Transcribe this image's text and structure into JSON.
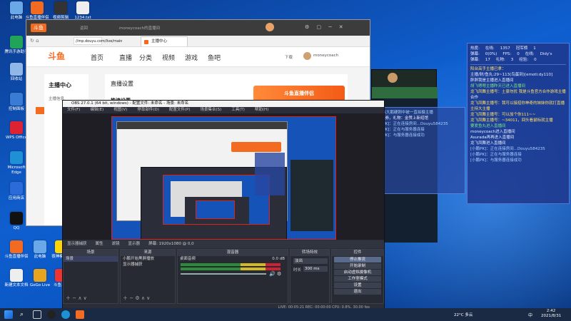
{
  "desktop": {
    "icons": [
      {
        "label": "此电脑",
        "color": "#6aa8e8"
      },
      {
        "label": "斗鱼直播伴侣",
        "color": "#f36b21"
      },
      {
        "label": "视频剪辑",
        "color": "#333"
      },
      {
        "label": "1234.txt",
        "color": "#eee"
      },
      {
        "label": "腾讯手游助手",
        "color": "#22a35a"
      },
      {
        "label": "回收站",
        "color": "#8fb8e8"
      },
      {
        "label": "控制面板",
        "color": "#3a7bd5"
      },
      {
        "label": "WPS Office",
        "color": "#d23"
      },
      {
        "label": "Microsoft Edge",
        "color": "#1f8fd6"
      },
      {
        "label": "应用商店",
        "color": "#2a6bd9"
      },
      {
        "label": "QQ",
        "color": "#111"
      },
      {
        "label": "斗鱼直播伴侣",
        "color": "#f36b21"
      },
      {
        "label": "此电脑",
        "color": "#6aa8e8"
      },
      {
        "label": "夜神模拟器",
        "color": "#ffd400"
      },
      {
        "label": "新建文本文档",
        "color": "#eee"
      },
      {
        "label": "GoGo Live",
        "color": "#e8a41f"
      },
      {
        "label": "斗鱼工具",
        "color": "#e33"
      }
    ]
  },
  "browser": {
    "title": "moneycoach的直播间",
    "tab": "主播中心",
    "url": "//mp.douyu.com/live/main",
    "logo": "斗鱼",
    "nav": [
      "首页",
      "直播",
      "分类",
      "视频",
      "游戏",
      "鱼吧"
    ],
    "user": "moneycoach",
    "download": "下载",
    "sidebar_title": "主播中心",
    "sidebar_item": "主播信息",
    "content_title": "直播设置",
    "content_sub": "推流设置",
    "banner": "斗鱼直播伴侣"
  },
  "obs": {
    "title": "OBS 27.0.1 (64 bit, windows) - 配置文件: 未命名 - 场景: 未命名",
    "menu": [
      "文件(F)",
      "编辑(E)",
      "视图(V)",
      "停靠部件(D)",
      "配置文件(P)",
      "场景集合(S)",
      "工具(T)",
      "帮助(H)"
    ],
    "source_bar": [
      "显示器捕获",
      "属性",
      "滤镜",
      "显示器",
      "屏幕: 1920x1080 @ 0,0"
    ],
    "docks": {
      "scenes": {
        "header": "场景",
        "items": [
          "场景"
        ]
      },
      "sources": {
        "header": "来源",
        "items": [
          "小鹏开始黑屏播放",
          "显示器捕获"
        ]
      },
      "mixer": {
        "header": "混音器",
        "items": [
          "桌面音频"
        ],
        "level": "0.0 dB"
      },
      "transitions": {
        "header": "转场特效",
        "value": "淡出",
        "duration_label": "时长",
        "duration": "300 ms"
      },
      "controls": {
        "header": "控件",
        "buttons": [
          "停止推流",
          "开始录制",
          "启动虚拟摄像机",
          "工作室模式",
          "设置",
          "退出"
        ]
      }
    },
    "status": "LIVE: 00:05:21   REC: 00:00:00   CPU: 0.8%, 30.00 fps"
  },
  "chat_left": {
    "lines": [
      {
        "t": "小鹏PK大鹅硬刚中被一直拍摄主播",
        "c": "c"
      },
      {
        "t": "点兑换券，礼物：金赞上新绍馆",
        "c": ""
      },
      {
        "t": "[小鹏PK]：正在连接房间...Douyu584235",
        "c": "c"
      },
      {
        "t": "[小鹏PK]：正在与服务器连接",
        "c": "c"
      },
      {
        "t": "[小鹏PK]：与服务器连接成功",
        "c": "c"
      }
    ]
  },
  "chat_right": {
    "stats": [
      [
        "热度:",
        "在线:",
        "1357",
        "冠军榜",
        "1"
      ],
      [
        "弹幕:",
        "0(0%)",
        "FPS:",
        "0",
        "在线:",
        "Didy's"
      ],
      [
        "弹幕:",
        "17",
        "礼物:",
        "3",
        "经验:",
        "0"
      ]
    ],
    "lines": [
      {
        "t": "阳台高手主播已拿：",
        "c": "y"
      },
      {
        "t": "主播/财/鱼丸:29~113(鸟蛋到)[emoti:dy110]",
        "c": ""
      },
      {
        "t": "胖胖我是主播进入直播间",
        "c": ""
      },
      {
        "t": "胡飞嗯嗯主播昨天已进入直播间",
        "c": "g"
      },
      {
        "t": "龙飞凤舞主播号：土豪勿扰 我是斗鱼官方合作游戏主播",
        "c": "y"
      },
      {
        "t": "合作",
        "c": ""
      },
      {
        "t": "龙飞凤舞主播号：我可以接招你神奇的妹妹你就打直播主持大主播",
        "c": "y"
      },
      {
        "t": "龙飞凤舞主播号：可以加个你111~~",
        "c": "y"
      },
      {
        "t": "龙飞凤舞主播号：~34011，回头看鼠标就主播",
        "c": "y"
      },
      {
        "t": "要爱鱼丸进入直播间",
        "c": "g"
      },
      {
        "t": "moneycoach进入直播间",
        "c": ""
      },
      {
        "t": "Asurada再再进入直播间",
        "c": ""
      },
      {
        "t": "龙飞凤舞进入直播间",
        "c": ""
      },
      {
        "t": "[小鹏PK]：正在连接房间...Douyu584235",
        "c": "c"
      },
      {
        "t": "[小鹏PK]：正在与服务器连接",
        "c": "c"
      },
      {
        "t": "[小鹏PK]：与服务器连接成功",
        "c": "c"
      }
    ]
  },
  "taskbar": {
    "weather": "22°C 多云",
    "time": "2:42",
    "date": "2021/8/31",
    "lang": "中"
  }
}
